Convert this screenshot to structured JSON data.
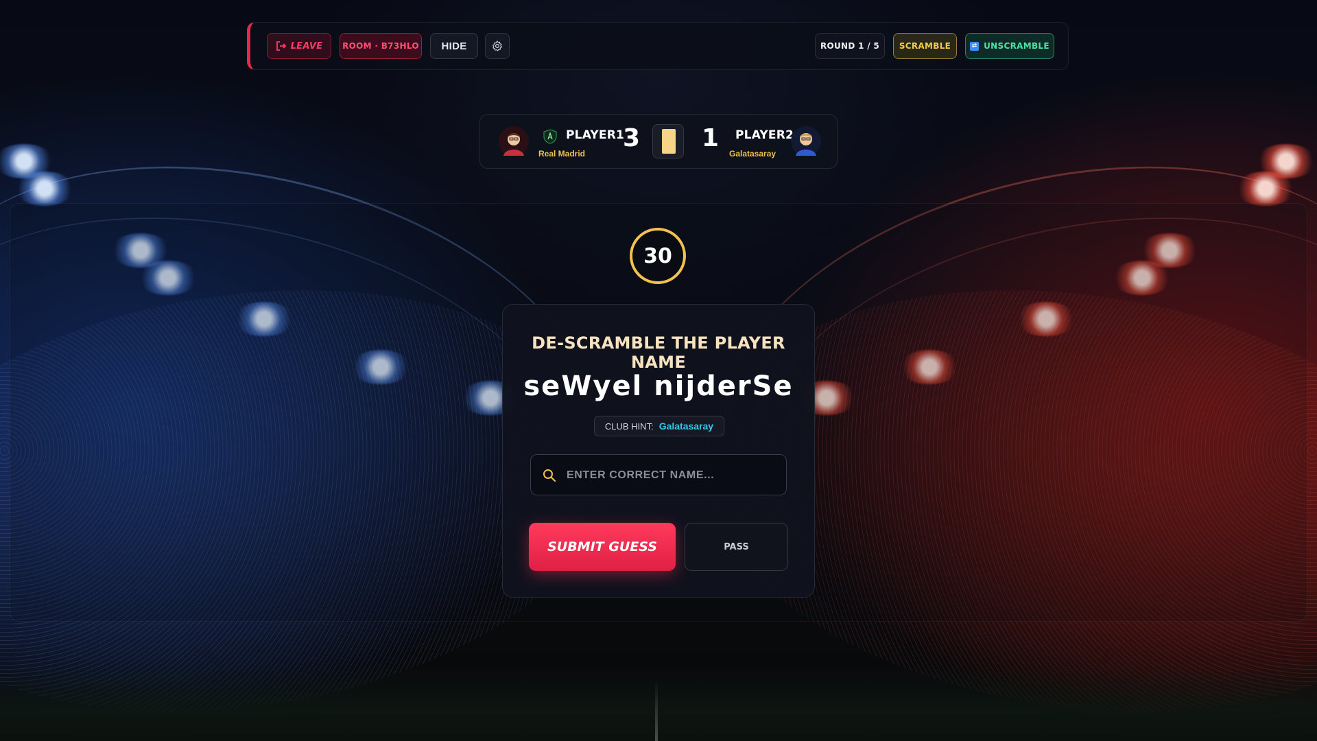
{
  "topbar": {
    "leave_label": "LEAVE",
    "room_label": "ROOM · B73HLO",
    "hide_label": "HIDE",
    "round_label": "ROUND 1 / 5",
    "scramble_label": "SCRAMBLE",
    "unscramble_label": "UNSCRAMBLE"
  },
  "scoreboard": {
    "player1": {
      "name": "PLAYER1",
      "club": "Real Madrid",
      "score": "3"
    },
    "player2": {
      "name": "PLAYER2",
      "club": "Galatasaray",
      "score": "1"
    }
  },
  "timer": {
    "value": "30"
  },
  "game": {
    "title": "DE-SCRAMBLE THE PLAYER NAME",
    "scrambled_name": "seWyel nijderSe",
    "hint_label": "CLUB HINT:",
    "hint_value": "Galatasaray",
    "input_placeholder": "ENTER CORRECT NAME...",
    "input_value": "",
    "submit_label": "SUBMIT GUESS",
    "pass_label": "PASS"
  },
  "colors": {
    "accent_red": "#e8274a",
    "gold": "#f2c14e",
    "hint_cyan": "#35c7e8",
    "unscramble_green": "#4de3a4"
  },
  "icons": {
    "leave": "logout-icon",
    "settings": "gear-icon",
    "unscramble": "shuffle-square-icon",
    "search": "search-icon",
    "player1_avatar": "avatar-red-shirt",
    "player2_avatar": "avatar-blue-shirt",
    "player1_badge": "club-badge-icon",
    "card": "yellow-card-icon"
  }
}
